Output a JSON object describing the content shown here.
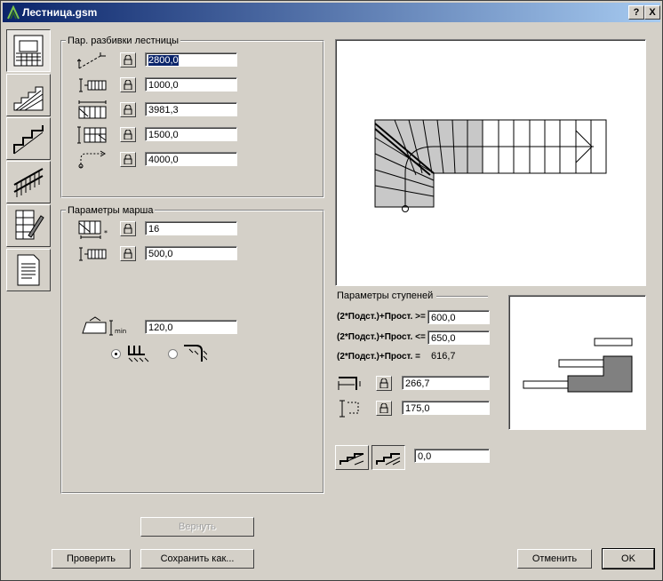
{
  "window": {
    "title": "Лестница.gsm",
    "help_label": "?",
    "close_label": "X"
  },
  "tabs": [
    {
      "name": "plan"
    },
    {
      "name": "section"
    },
    {
      "name": "stair-3d"
    },
    {
      "name": "railing"
    },
    {
      "name": "tools"
    },
    {
      "name": "document"
    }
  ],
  "breakdown": {
    "title": "Пар. разбивки лестницы",
    "values": [
      "2800,0",
      "1000,0",
      "3981,3",
      "1500,0",
      "4000,0"
    ]
  },
  "flight": {
    "title": "Параметры марша",
    "values": [
      "16",
      "500,0"
    ],
    "min_value": "120,0"
  },
  "steps": {
    "title": "Параметры ступеней",
    "rule1_label": "(2*Подст.)+Прост. >=",
    "rule1_value": "600,0",
    "rule2_label": "(2*Подст.)+Прост. <=",
    "rule2_value": "650,0",
    "rule3_label": "(2*Подст.)+Прост. =",
    "rule3_value": "616,7",
    "tread_value": "266,7",
    "riser_value": "175,0",
    "offset_value": "0,0"
  },
  "buttons": {
    "revert": "Вернуть",
    "check": "Проверить",
    "save_as": "Сохранить как...",
    "cancel": "Отменить",
    "ok": "OK"
  }
}
